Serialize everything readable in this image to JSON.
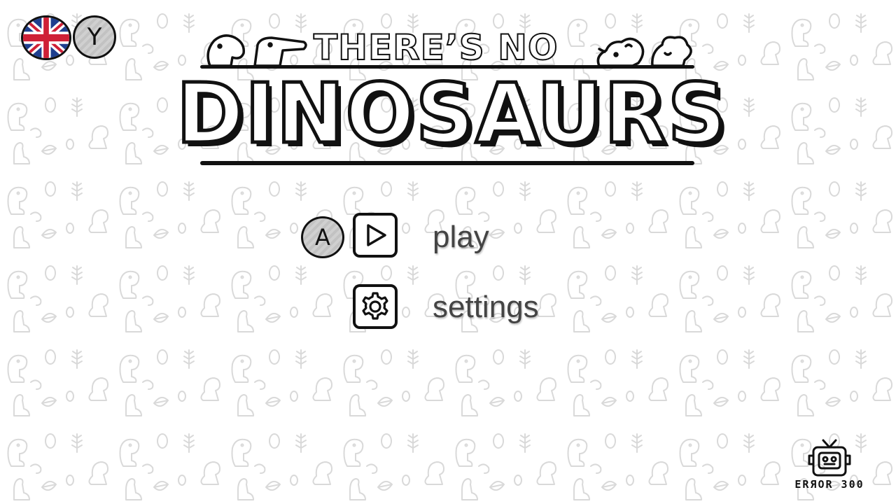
{
  "game": {
    "title_line1": "THERE’S NO",
    "title_line2": "DINOSAURS"
  },
  "controls": {
    "language_key": "Y",
    "language_flag": "united-kingdom-flag-icon",
    "confirm_key": "A"
  },
  "menu": {
    "items": [
      {
        "label": "play",
        "icon": "play-icon"
      },
      {
        "label": "settings",
        "icon": "gear-icon"
      }
    ]
  },
  "studio": {
    "name": "ERЯOR 300"
  },
  "colors": {
    "background": "#ffffff",
    "pattern": "#d8d8d8",
    "ink": "#111111",
    "menu_text": "#444444",
    "key_fill": "#c8c8c8",
    "flag_blue": "#1f3f8f",
    "flag_red": "#cf2036"
  }
}
